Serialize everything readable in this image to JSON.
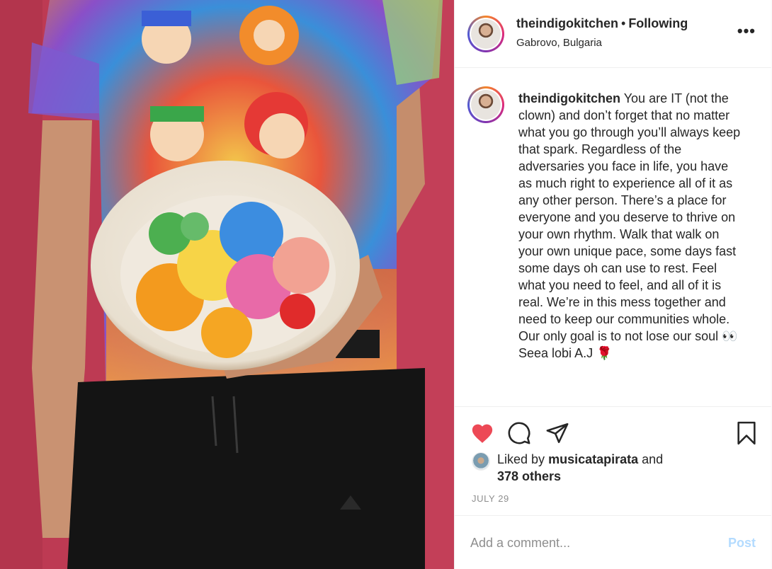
{
  "post": {
    "username": "theindigokitchen",
    "separator": "•",
    "follow_status": "Following",
    "location": "Gabrovo, Bulgaria",
    "more_label": "•••"
  },
  "caption": {
    "username": "theindigokitchen",
    "text": "You are IT (not the clown) and don’t forget that no matter what you go through you’ll always keep that spark. Regardless of the adversaries you face in life, you have as much right to experience all of it as any other person. There’s a place for everyone and you deserve to thrive on your own rhythm. Walk that walk on your own unique pace, some days fast some days oh can use to rest. Feel what you need to feel, and all of it is real. We’re in this mess together and need to keep our communities whole. Our only goal is to not lose our soul 👀",
    "signoff": "Seea lobi A.J 🌹"
  },
  "actions": {
    "liked_prefix": "Liked by",
    "liked_user": "musicatapirata",
    "liked_and": "and",
    "liked_others": "378 others",
    "date": "JULY 29"
  },
  "comment": {
    "placeholder": "Add a comment...",
    "post_label": "Post"
  },
  "icons": {
    "heart": "heart-filled-icon",
    "comment": "comment-icon",
    "share": "share-icon",
    "bookmark": "bookmark-icon",
    "more": "more-options-icon"
  },
  "colors": {
    "heart": "#ed4956",
    "post_disabled": "#b3dbff",
    "muted": "#8e8e8e",
    "text": "#262626"
  }
}
